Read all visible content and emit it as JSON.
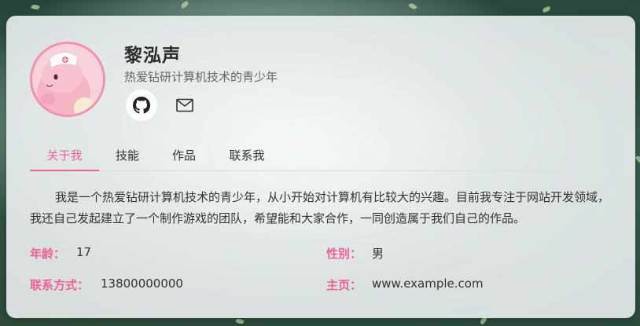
{
  "profile": {
    "name": "黎泓声",
    "tagline": "热爱钻研计算机技术的青少年",
    "avatar_alt": "avatar"
  },
  "social": {
    "github_icon": "github-icon",
    "mail_icon": "mail-icon"
  },
  "tabs": [
    {
      "label": "关于我"
    },
    {
      "label": "技能"
    },
    {
      "label": "作品"
    },
    {
      "label": "联系我"
    }
  ],
  "about": {
    "text": "我是一个热爱钻研计算机技术的青少年，从小开始对计算机有比较大的兴趣。目前我专注于网站开发领域，我还自己发起建立了一个制作游戏的团队，希望能和大家合作，一同创造属于我们自己的作品。"
  },
  "info": {
    "age_label": "年龄：",
    "age_value": "17",
    "gender_label": "性别：",
    "gender_value": "男",
    "contact_label": "联系方式：",
    "contact_value": "13800000000",
    "homepage_label": "主页：",
    "homepage_value": "www.example.com"
  },
  "colors": {
    "accent": "#f06292",
    "avatar_border": "#f48fb1"
  }
}
